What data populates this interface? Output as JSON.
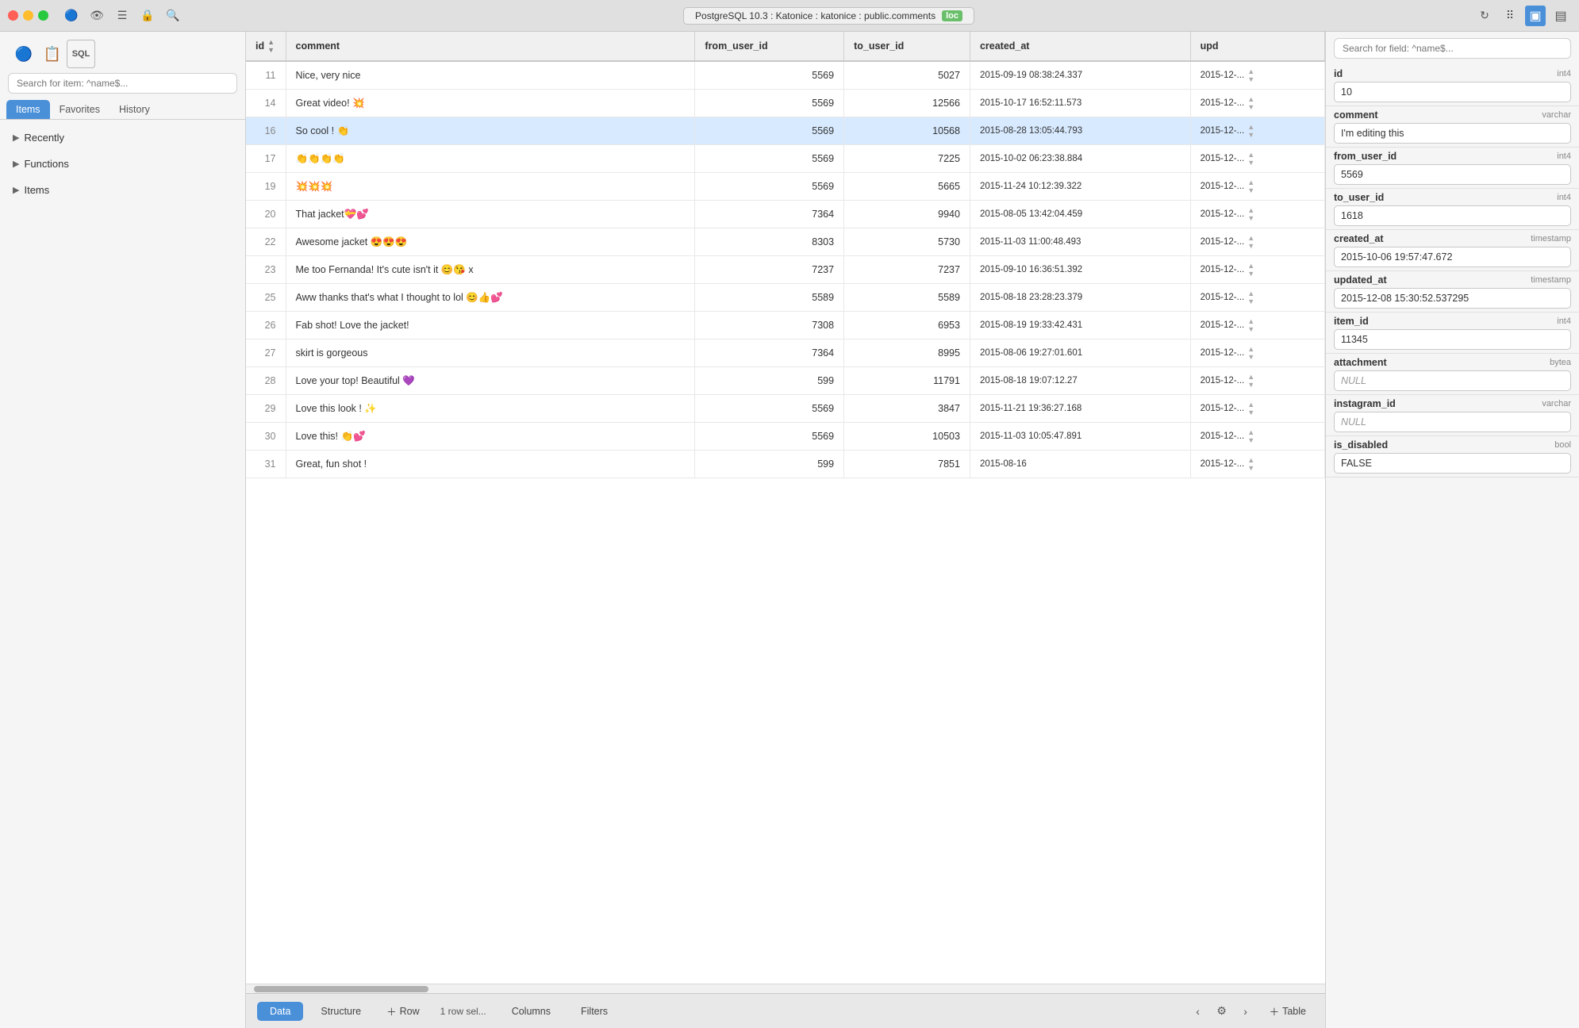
{
  "titlebar": {
    "connection": "PostgreSQL 10.3 : Katonice : katonice : public.comments",
    "loc_badge": "loc",
    "layout_icons": [
      "⊞",
      "▣",
      "▤"
    ]
  },
  "sidebar": {
    "search_placeholder": "Search for item: ^name$...",
    "tabs": [
      "Items",
      "Favorites",
      "History"
    ],
    "active_tab": "Items",
    "sections": [
      {
        "label": "Recently",
        "expanded": false
      },
      {
        "label": "Functions",
        "expanded": false
      },
      {
        "label": "Items",
        "expanded": false
      }
    ]
  },
  "table": {
    "columns": [
      "id",
      "comment",
      "from_user_id",
      "to_user_id",
      "created_at",
      "upd"
    ],
    "rows": [
      {
        "id": 11,
        "comment": "Nice, very nice",
        "from_user_id": 5569,
        "to_user_id": 5027,
        "created_at": "2015-09-19 08:38:24.337",
        "upd": "2015-12-..."
      },
      {
        "id": 14,
        "comment": "Great video! 💥",
        "from_user_id": 5569,
        "to_user_id": 12566,
        "created_at": "2015-10-17 16:52:11.573",
        "upd": "2015-12-..."
      },
      {
        "id": 16,
        "comment": "So cool ! 👏",
        "from_user_id": 5569,
        "to_user_id": 10568,
        "created_at": "2015-08-28 13:05:44.793",
        "upd": "2015-12-..."
      },
      {
        "id": 17,
        "comment": "👏👏👏👏",
        "from_user_id": 5569,
        "to_user_id": 7225,
        "created_at": "2015-10-02 06:23:38.884",
        "upd": "2015-12-..."
      },
      {
        "id": 19,
        "comment": "💥💥💥",
        "from_user_id": 5569,
        "to_user_id": 5665,
        "created_at": "2015-11-24 10:12:39.322",
        "upd": "2015-12-..."
      },
      {
        "id": 20,
        "comment": "That jacket💝💕",
        "from_user_id": 7364,
        "to_user_id": 9940,
        "created_at": "2015-08-05 13:42:04.459",
        "upd": "2015-12-..."
      },
      {
        "id": 22,
        "comment": "Awesome jacket 😍😍😍",
        "from_user_id": 8303,
        "to_user_id": 5730,
        "created_at": "2015-11-03 11:00:48.493",
        "upd": "2015-12-..."
      },
      {
        "id": 23,
        "comment": "Me too Fernanda! It's cute isn't it 😊😘 x",
        "from_user_id": 7237,
        "to_user_id": 7237,
        "created_at": "2015-09-10 16:36:51.392",
        "upd": "2015-12-..."
      },
      {
        "id": 25,
        "comment": "Aww thanks that's what I thought to lol 😊👍💕",
        "from_user_id": 5589,
        "to_user_id": 5589,
        "created_at": "2015-08-18 23:28:23.379",
        "upd": "2015-12-..."
      },
      {
        "id": 26,
        "comment": "Fab shot! Love the jacket!",
        "from_user_id": 7308,
        "to_user_id": 6953,
        "created_at": "2015-08-19 19:33:42.431",
        "upd": "2015-12-..."
      },
      {
        "id": 27,
        "comment": "skirt is gorgeous",
        "from_user_id": 7364,
        "to_user_id": 8995,
        "created_at": "2015-08-06 19:27:01.601",
        "upd": "2015-12-..."
      },
      {
        "id": 28,
        "comment": "Love your top! Beautiful 💜",
        "from_user_id": 599,
        "to_user_id": 11791,
        "created_at": "2015-08-18 19:07:12.27",
        "upd": "2015-12-..."
      },
      {
        "id": 29,
        "comment": "Love this look ! ✨",
        "from_user_id": 5569,
        "to_user_id": 3847,
        "created_at": "2015-11-21 19:36:27.168",
        "upd": "2015-12-..."
      },
      {
        "id": 30,
        "comment": "Love this! 👏💕",
        "from_user_id": 5569,
        "to_user_id": 10503,
        "created_at": "2015-11-03 10:05:47.891",
        "upd": "2015-12-..."
      },
      {
        "id": 31,
        "comment": "Great, fun shot !",
        "from_user_id": 599,
        "to_user_id": 7851,
        "created_at": "2015-08-16",
        "upd": "2015-12-..."
      }
    ],
    "selected_row_id": 16
  },
  "right_panel": {
    "search_placeholder": "Search for field: ^name$...",
    "fields": [
      {
        "name": "id",
        "type": "int4",
        "value": "10",
        "is_null": false
      },
      {
        "name": "comment",
        "type": "varchar",
        "value": "I'm editing this",
        "is_null": false
      },
      {
        "name": "from_user_id",
        "type": "int4",
        "value": "5569",
        "is_null": false
      },
      {
        "name": "to_user_id",
        "type": "int4",
        "value": "1618",
        "is_null": false
      },
      {
        "name": "created_at",
        "type": "timestamp",
        "value": "2015-10-06 19:57:47.672",
        "is_null": false
      },
      {
        "name": "updated_at",
        "type": "timestamp",
        "value": "2015-12-08 15:30:52.537295",
        "is_null": false
      },
      {
        "name": "item_id",
        "type": "int4",
        "value": "11345",
        "is_null": false
      },
      {
        "name": "attachment",
        "type": "bytea",
        "value": "NULL",
        "is_null": true
      },
      {
        "name": "instagram_id",
        "type": "varchar",
        "value": "NULL",
        "is_null": true
      },
      {
        "name": "is_disabled",
        "type": "bool",
        "value": "FALSE",
        "is_null": false
      }
    ]
  },
  "bottom_bar": {
    "tabs": [
      "Data",
      "Structure",
      "Row",
      "Columns",
      "Filters"
    ],
    "active_tab": "Data",
    "add_label": "Table",
    "row_label": "Row",
    "selection_info": "1 row sel..."
  }
}
